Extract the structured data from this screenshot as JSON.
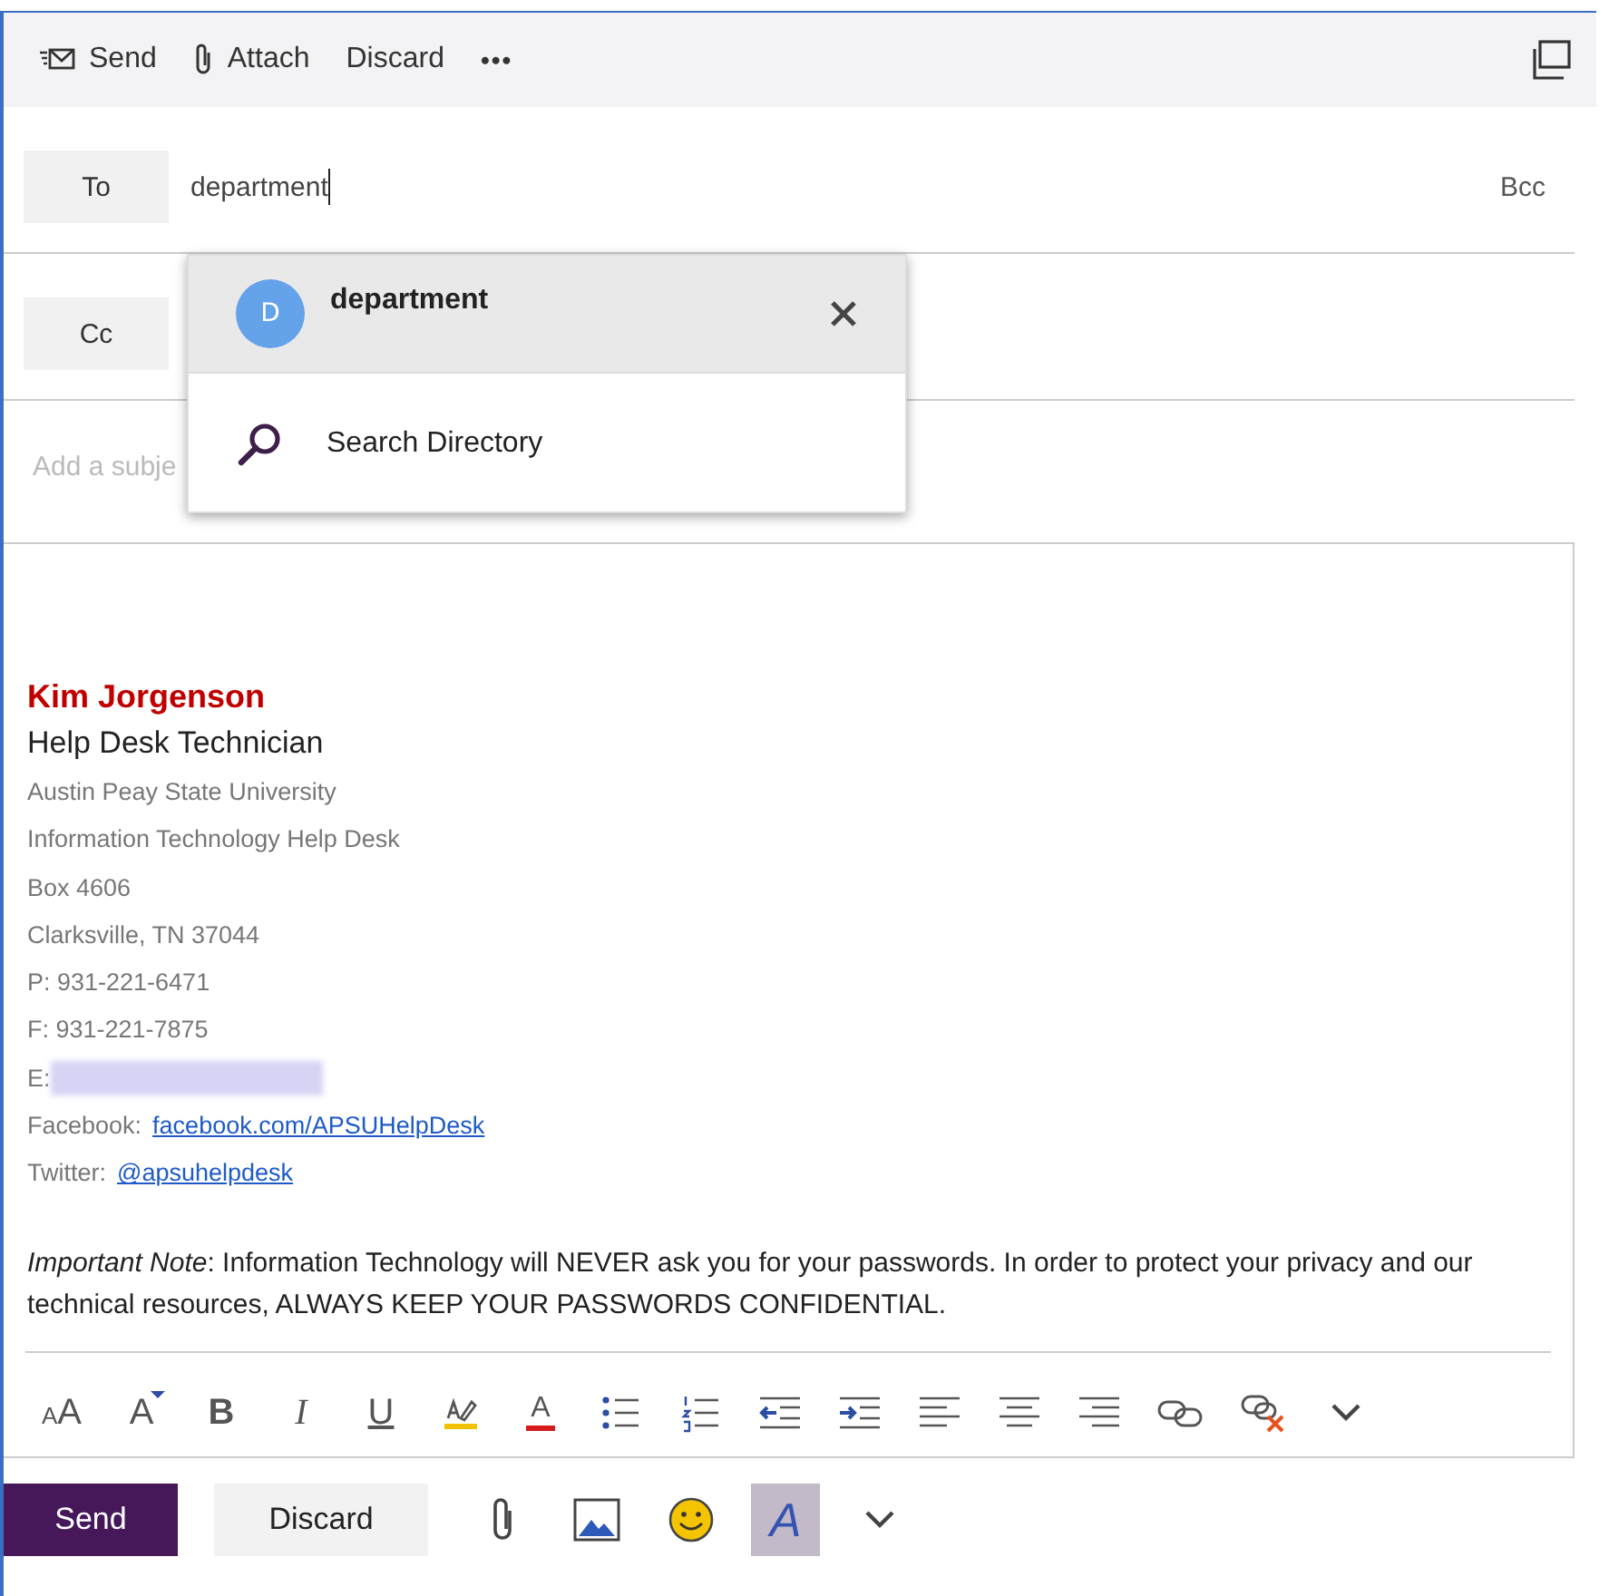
{
  "toolbar": [
    {
      "kind": "send",
      "label": "Send"
    },
    {
      "kind": "attach",
      "label": "Attach"
    },
    {
      "kind": "discard",
      "label": "Discard"
    },
    {
      "kind": "more",
      "label": "•••"
    }
  ],
  "to": {
    "label": "To",
    "value": "department",
    "bcc": "Bcc"
  },
  "cc": {
    "label": "Cc"
  },
  "subject": {
    "placeholder": "Add a subje"
  },
  "suggestions": [
    {
      "kind": "contact",
      "initial": "D",
      "name": "department",
      "selected": true
    },
    {
      "kind": "search",
      "label": "Search Directory",
      "selected": false
    }
  ],
  "signature": {
    "name": "Kim Jorgenson",
    "title": "Help Desk Technician",
    "lines": [
      {
        "kind": "text",
        "text": "Austin Peay State University"
      },
      {
        "kind": "text",
        "text": "Information Technology Help Desk"
      },
      {
        "kind": "text",
        "text": "Box 4606"
      },
      {
        "kind": "text",
        "text": "Clarksville, TN 37044"
      },
      {
        "kind": "text",
        "text": "P: 931-221-6471"
      },
      {
        "kind": "text",
        "text": "F: 931-221-7875"
      },
      {
        "kind": "redacted",
        "text": "E:"
      },
      {
        "kind": "link",
        "text": "Facebook:",
        "link": "facebook.com/APSUHelpDesk"
      },
      {
        "kind": "link",
        "text": "Twitter:",
        "link": "@apsuhelpdesk"
      }
    ],
    "note": "*Important Note*: Information Technology will NEVER ask you for your passwords. In order to protect your privacy and our technical resources, ALWAYS KEEP YOUR PASSWORDS CONFIDENTIAL."
  },
  "format_tools": [
    {
      "kind": "font-size",
      "glyph": "AA"
    },
    {
      "kind": "grow",
      "glyph": "A"
    },
    {
      "kind": "bold",
      "glyph": "B"
    },
    {
      "kind": "italic",
      "glyph": "I"
    },
    {
      "kind": "underline",
      "glyph": "U"
    },
    {
      "kind": "highlight"
    },
    {
      "kind": "color",
      "glyph": "A"
    },
    {
      "kind": "bullets"
    },
    {
      "kind": "numbering"
    },
    {
      "kind": "outdent"
    },
    {
      "kind": "indent"
    },
    {
      "kind": "align-left"
    },
    {
      "kind": "align-center"
    },
    {
      "kind": "align-right"
    },
    {
      "kind": "link"
    },
    {
      "kind": "unlink"
    },
    {
      "kind": "chevron"
    }
  ],
  "footer": {
    "send": "Send",
    "discard": "Discard",
    "tools": [
      {
        "kind": "attach",
        "selected": false
      },
      {
        "kind": "image",
        "selected": false
      },
      {
        "kind": "emoji",
        "selected": false
      },
      {
        "kind": "format",
        "glyph": "A",
        "selected": true
      },
      {
        "kind": "chevron",
        "selected": false
      }
    ]
  }
}
